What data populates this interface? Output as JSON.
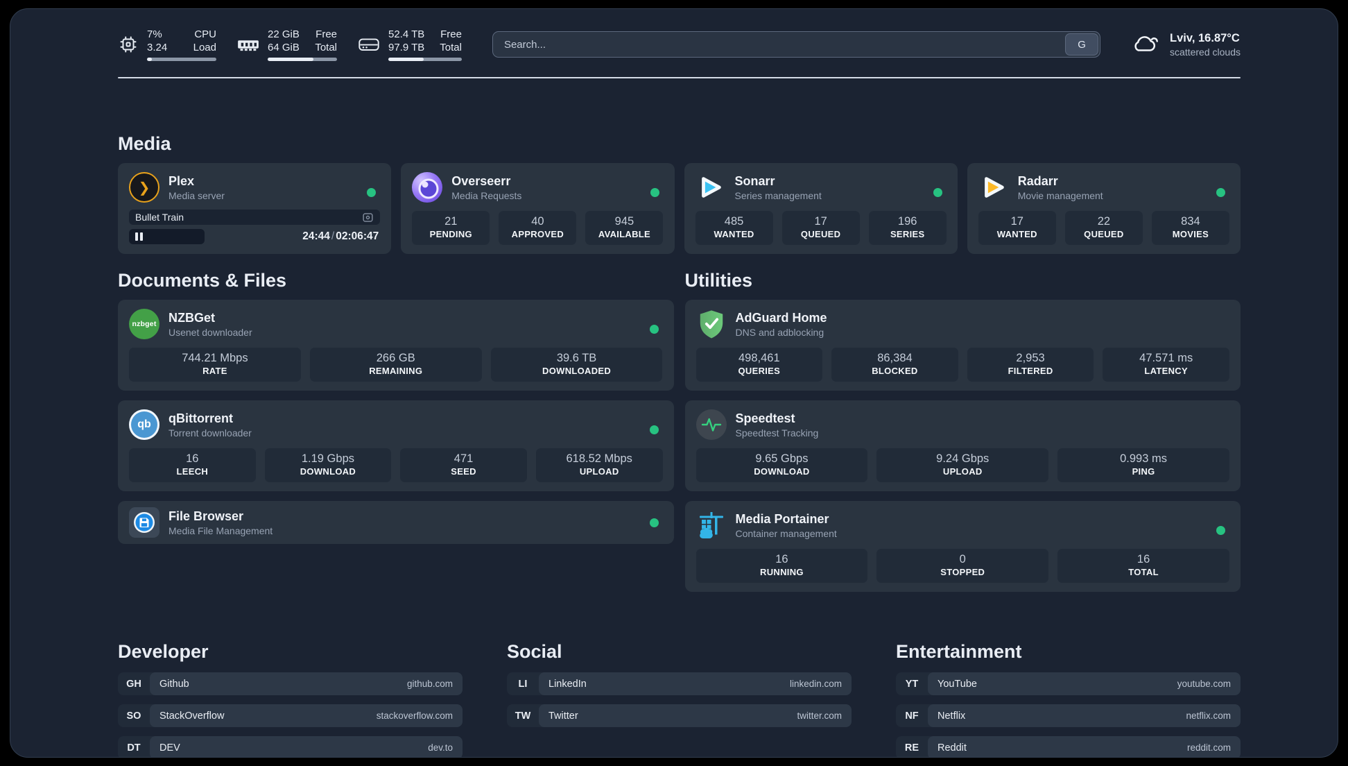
{
  "header": {
    "stats": [
      {
        "id": "cpu",
        "top_value": "7%",
        "bottom_value": "3.24",
        "top_label": "CPU",
        "bottom_label": "Load",
        "progress_pct": 7
      },
      {
        "id": "memory",
        "top_value": "22 GiB",
        "bottom_value": "64 GiB",
        "top_label": "Free",
        "bottom_label": "Total",
        "progress_pct": 66
      },
      {
        "id": "storage",
        "top_value": "52.4 TB",
        "bottom_value": "97.9 TB",
        "top_label": "Free",
        "bottom_label": "Total",
        "progress_pct": 48
      }
    ],
    "search_placeholder": "Search...",
    "search_button": "G",
    "weather": {
      "title": "Lviv, 16.87°C",
      "subtitle": "scattered clouds"
    }
  },
  "sections": {
    "media": "Media",
    "documents": "Documents & Files",
    "utilities": "Utilities",
    "developer": "Developer",
    "social": "Social",
    "entertainment": "Entertainment"
  },
  "apps": {
    "plex": {
      "title": "Plex",
      "subtitle": "Media server",
      "now_playing": {
        "title": "Bullet Train",
        "elapsed": "24:44",
        "separator": "/",
        "duration": "02:06:47",
        "progress_pct": 30
      }
    },
    "overseerr": {
      "title": "Overseerr",
      "subtitle": "Media Requests",
      "stats": [
        {
          "value": "21",
          "label": "PENDING"
        },
        {
          "value": "40",
          "label": "APPROVED"
        },
        {
          "value": "945",
          "label": "AVAILABLE"
        }
      ]
    },
    "sonarr": {
      "title": "Sonarr",
      "subtitle": "Series management",
      "stats": [
        {
          "value": "485",
          "label": "WANTED"
        },
        {
          "value": "17",
          "label": "QUEUED"
        },
        {
          "value": "196",
          "label": "SERIES"
        }
      ]
    },
    "radarr": {
      "title": "Radarr",
      "subtitle": "Movie management",
      "stats": [
        {
          "value": "17",
          "label": "WANTED"
        },
        {
          "value": "22",
          "label": "QUEUED"
        },
        {
          "value": "834",
          "label": "MOVIES"
        }
      ]
    },
    "nzbget": {
      "title": "NZBGet",
      "subtitle": "Usenet downloader",
      "icon_text": "nzbget",
      "stats": [
        {
          "value": "744.21 Mbps",
          "label": "RATE"
        },
        {
          "value": "266 GB",
          "label": "REMAINING"
        },
        {
          "value": "39.6 TB",
          "label": "DOWNLOADED"
        }
      ]
    },
    "qbittorrent": {
      "title": "qBittorrent",
      "subtitle": "Torrent downloader",
      "icon_text": "qb",
      "stats": [
        {
          "value": "16",
          "label": "LEECH"
        },
        {
          "value": "1.19 Gbps",
          "label": "DOWNLOAD"
        },
        {
          "value": "471",
          "label": "SEED"
        },
        {
          "value": "618.52 Mbps",
          "label": "UPLOAD"
        }
      ]
    },
    "filebrowser": {
      "title": "File Browser",
      "subtitle": "Media File Management"
    },
    "adguard": {
      "title": "AdGuard Home",
      "subtitle": "DNS and adblocking",
      "stats": [
        {
          "value": "498,461",
          "label": "QUERIES"
        },
        {
          "value": "86,384",
          "label": "BLOCKED"
        },
        {
          "value": "2,953",
          "label": "FILTERED"
        },
        {
          "value": "47.571 ms",
          "label": "LATENCY"
        }
      ]
    },
    "speedtest": {
      "title": "Speedtest",
      "subtitle": "Speedtest Tracking",
      "stats": [
        {
          "value": "9.65 Gbps",
          "label": "DOWNLOAD"
        },
        {
          "value": "9.24 Gbps",
          "label": "UPLOAD"
        },
        {
          "value": "0.993 ms",
          "label": "PING"
        }
      ]
    },
    "portainer": {
      "title": "Media Portainer",
      "subtitle": "Container management",
      "stats": [
        {
          "value": "16",
          "label": "RUNNING"
        },
        {
          "value": "0",
          "label": "STOPPED"
        },
        {
          "value": "16",
          "label": "TOTAL"
        }
      ]
    }
  },
  "links": {
    "developer": [
      {
        "badge": "GH",
        "name": "Github",
        "url": "github.com"
      },
      {
        "badge": "SO",
        "name": "StackOverflow",
        "url": "stackoverflow.com"
      },
      {
        "badge": "DT",
        "name": "DEV",
        "url": "dev.to"
      }
    ],
    "social": [
      {
        "badge": "LI",
        "name": "LinkedIn",
        "url": "linkedin.com"
      },
      {
        "badge": "TW",
        "name": "Twitter",
        "url": "twitter.com"
      }
    ],
    "entertainment": [
      {
        "badge": "YT",
        "name": "YouTube",
        "url": "youtube.com"
      },
      {
        "badge": "NF",
        "name": "Netflix",
        "url": "netflix.com"
      },
      {
        "badge": "RE",
        "name": "Reddit",
        "url": "reddit.com"
      }
    ]
  },
  "colors": {
    "online_dot": "#27c281",
    "accent_gold": "#e9a21b",
    "accent_blue": "#39c1f2",
    "accent_yellow": "#fdb927"
  }
}
